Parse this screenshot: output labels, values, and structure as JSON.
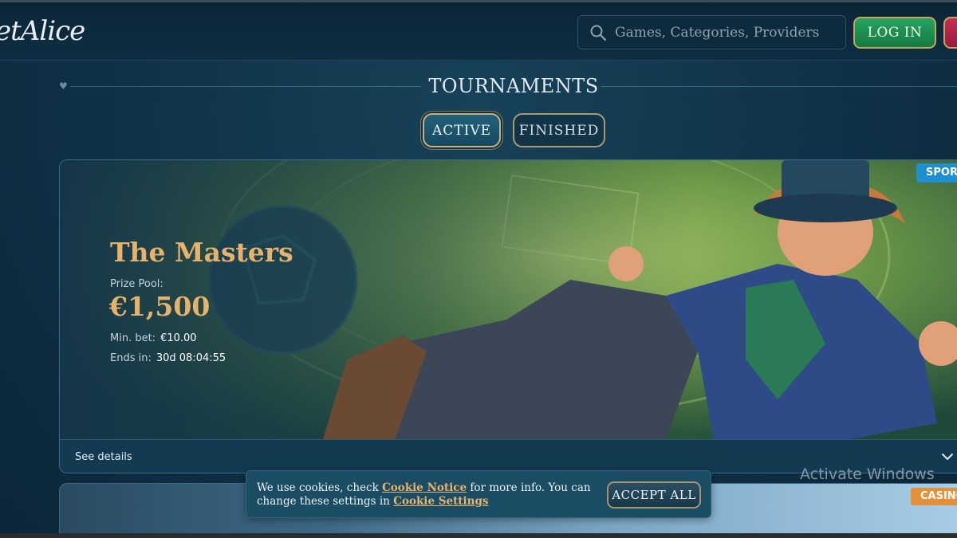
{
  "header": {
    "logo_text": "etAlice",
    "search_placeholder": "Games, Categories, Providers",
    "login_label": "LOG IN"
  },
  "page": {
    "title": "TOURNAMENTS",
    "tabs": [
      {
        "label": "ACTIVE",
        "active": true
      },
      {
        "label": "FINISHED",
        "active": false
      }
    ]
  },
  "tournament": {
    "category_badge": "SPORT",
    "name": "The Masters",
    "prize_pool_label": "Prize Pool:",
    "prize_pool_value": "€1,500",
    "min_bet_label": "Min. bet:",
    "min_bet_value": "€10.00",
    "ends_in_label": "Ends in:",
    "ends_in_value": "30d 08:04:55",
    "details_label": "See details"
  },
  "next_tournament": {
    "category_badge": "CASINO"
  },
  "cookie_banner": {
    "text_1": "We use cookies, check",
    "link_1": "Cookie Notice",
    "text_2": "for more info. You can change these settings in",
    "link_2": "Cookie Settings",
    "accept_label": "ACCEPT ALL"
  },
  "os": {
    "watermark": "Activate Windows"
  },
  "colors": {
    "background": "#0f3147",
    "accent_gold": "#e7b26c",
    "login_green": "#1f9457",
    "sport_badge": "#1e8fcf",
    "casino_badge": "#e2913a"
  }
}
